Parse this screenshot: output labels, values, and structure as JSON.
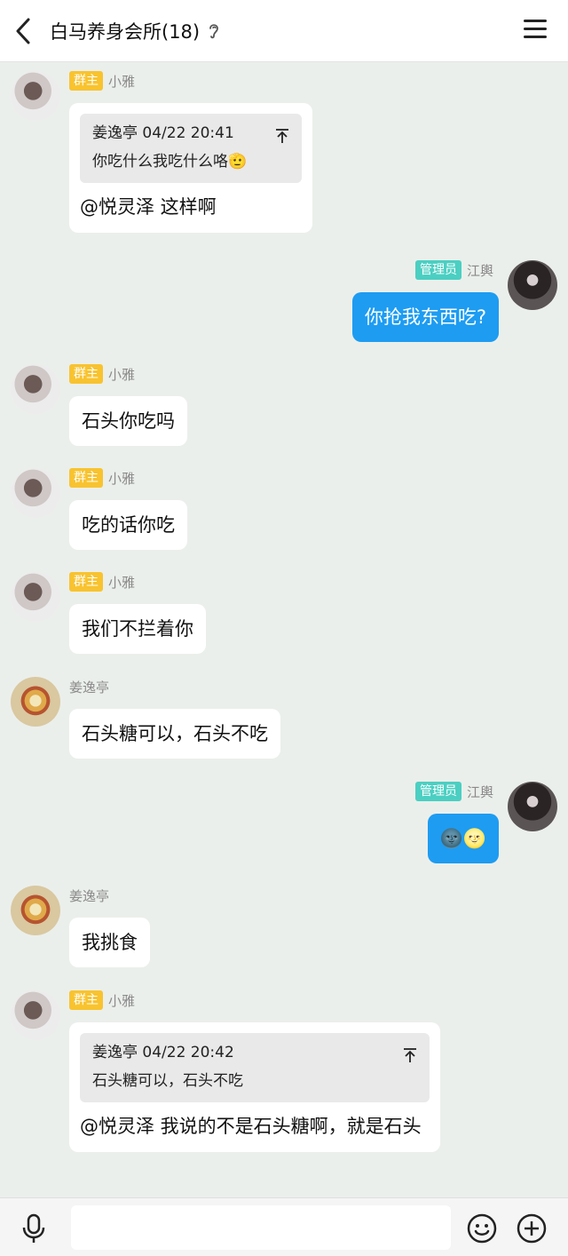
{
  "header": {
    "title": "白马养身会所(18)"
  },
  "messages": [
    {
      "sender": "小雅",
      "role": "群主",
      "quote": {
        "header": "姜逸亭 04/22 20:41",
        "text": "你吃什么我吃什么咯🫡"
      },
      "text": "@悦灵泽 这样啊"
    },
    {
      "sender": "江輿",
      "role": "管理员",
      "text": "你抢我东西吃?"
    },
    {
      "sender": "小雅",
      "role": "群主",
      "text": "石头你吃吗"
    },
    {
      "sender": "小雅",
      "role": "群主",
      "text": "吃的话你吃"
    },
    {
      "sender": "小雅",
      "role": "群主",
      "text": "我们不拦着你"
    },
    {
      "sender": "姜逸亭",
      "role": "",
      "text": "石头糖可以，石头不吃"
    },
    {
      "sender": "江輿",
      "role": "管理员",
      "text": "🌚🌝"
    },
    {
      "sender": "姜逸亭",
      "role": "",
      "text": "我挑食"
    },
    {
      "sender": "小雅",
      "role": "群主",
      "quote": {
        "header": "姜逸亭 04/22 20:42",
        "text": "石头糖可以，石头不吃"
      },
      "text": "@悦灵泽 我说的不是石头糖啊，就是石头"
    }
  ],
  "colors": {
    "background": "#ebefeb",
    "self_bubble": "#1d9cf2",
    "owner_badge": "#f8c32f",
    "admin_badge": "#4bcfc2"
  },
  "icons": [
    "back-arrow-icon",
    "ear-icon",
    "menu-icon",
    "pin-top-icon",
    "microphone-icon",
    "emoji-icon",
    "plus-icon"
  ]
}
